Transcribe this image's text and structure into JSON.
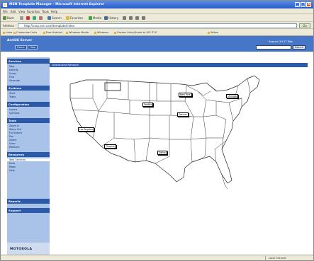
{
  "window": {
    "title": "MSN Template Manager - Microsoft Internet Explorer"
  },
  "menu": [
    "File",
    "Edit",
    "View",
    "Favorites",
    "Tools",
    "Help"
  ],
  "toolbar": {
    "back": "Back",
    "search": "Search",
    "favorites": "Favorites",
    "media": "Media",
    "history": "History"
  },
  "address": {
    "label": "Address",
    "value": "http://corp.esri.com/template/index",
    "go": "Go"
  },
  "links": [
    "Customize Links",
    "Free Hotmail",
    "Windows Media",
    "Windows",
    "Cashes Links/Quote to GIS IT-M",
    "Yellow"
  ],
  "banner": {
    "brand": "ArcGIS Server",
    "nav": [
      "Home",
      "Help"
    ],
    "search_label": "Search GIS IT Site",
    "search_button": "Search"
  },
  "sidebar": {
    "sections": [
      {
        "title": "Services",
        "items": [
          "Map",
          "Identify",
          "Query",
          "Find",
          "Geocode"
        ]
      },
      {
        "title": "Systems",
        "items": [
          "Start",
          "Tasks"
        ]
      },
      {
        "title": "Configuration",
        "items": [
          "Layers",
          "Symbols"
        ]
      },
      {
        "title": "Tools",
        "items": [
          "Zoom In",
          "Zoom Out",
          "Full Extent",
          "Pan",
          "Select",
          "Clear",
          "Measure"
        ]
      },
      {
        "title": "Resources",
        "items": [
          "Web Services",
          "Data",
          "Maps",
          "Help"
        ]
      },
      {
        "title": "Reports",
        "items": []
      },
      {
        "title": "Support",
        "items": []
      }
    ],
    "logo": "MOTOROLA"
  },
  "main": {
    "heading": "Distributed Network"
  },
  "markers": [
    "Seattle",
    "Denver",
    "Chicago",
    "New York",
    "Los Angeles",
    "Phoenix",
    "Dallas"
  ],
  "status": {
    "zone": "Local intranet"
  }
}
